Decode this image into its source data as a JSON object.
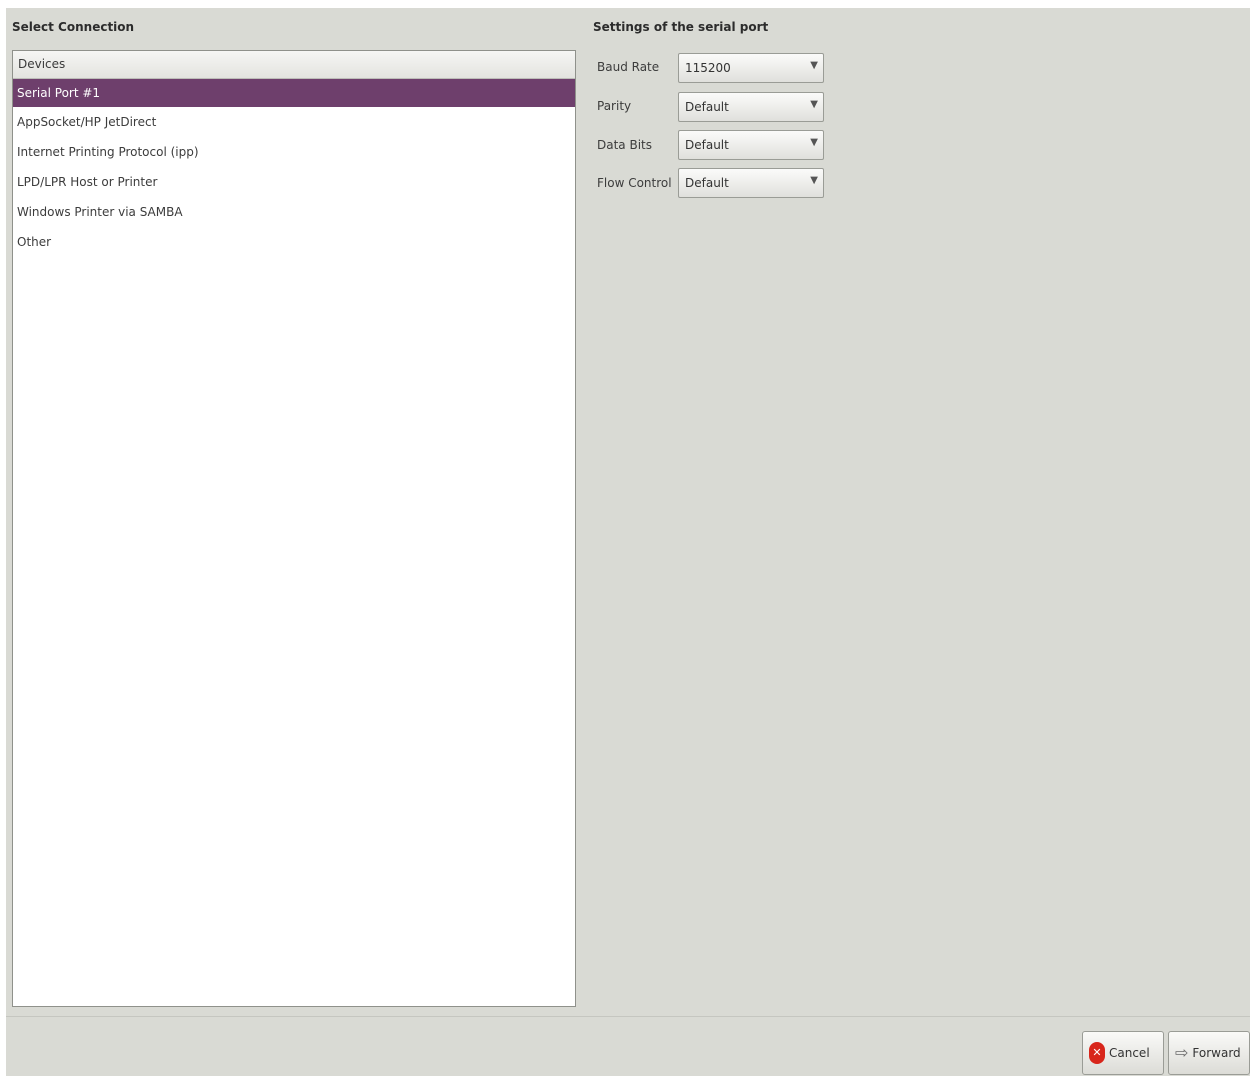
{
  "select_connection": {
    "title": "Select Connection",
    "header": "Devices",
    "items": [
      {
        "label": "Serial Port #1",
        "selected": true
      },
      {
        "label": "AppSocket/HP JetDirect",
        "selected": false
      },
      {
        "label": "Internet Printing Protocol (ipp)",
        "selected": false
      },
      {
        "label": "LPD/LPR Host or Printer",
        "selected": false
      },
      {
        "label": "Windows Printer via SAMBA",
        "selected": false
      },
      {
        "label": "Other",
        "selected": false
      }
    ]
  },
  "serial_settings": {
    "title": "Settings of the serial port",
    "fields": [
      {
        "label": "Baud Rate",
        "value": "115200"
      },
      {
        "label": "Parity",
        "value": "Default"
      },
      {
        "label": "Data Bits",
        "value": "Default"
      },
      {
        "label": "Flow Control",
        "value": "Default"
      }
    ]
  },
  "buttons": {
    "cancel": "Cancel",
    "forward": "Forward"
  },
  "colors": {
    "selection": "#6e3f6c",
    "window_bg": "#d9dad4",
    "cancel_icon": "#d8261b"
  },
  "icons": {
    "cancel": "stop-icon",
    "forward": "forward-arrow-icon",
    "combo_arrow": "chevron-down-icon"
  }
}
